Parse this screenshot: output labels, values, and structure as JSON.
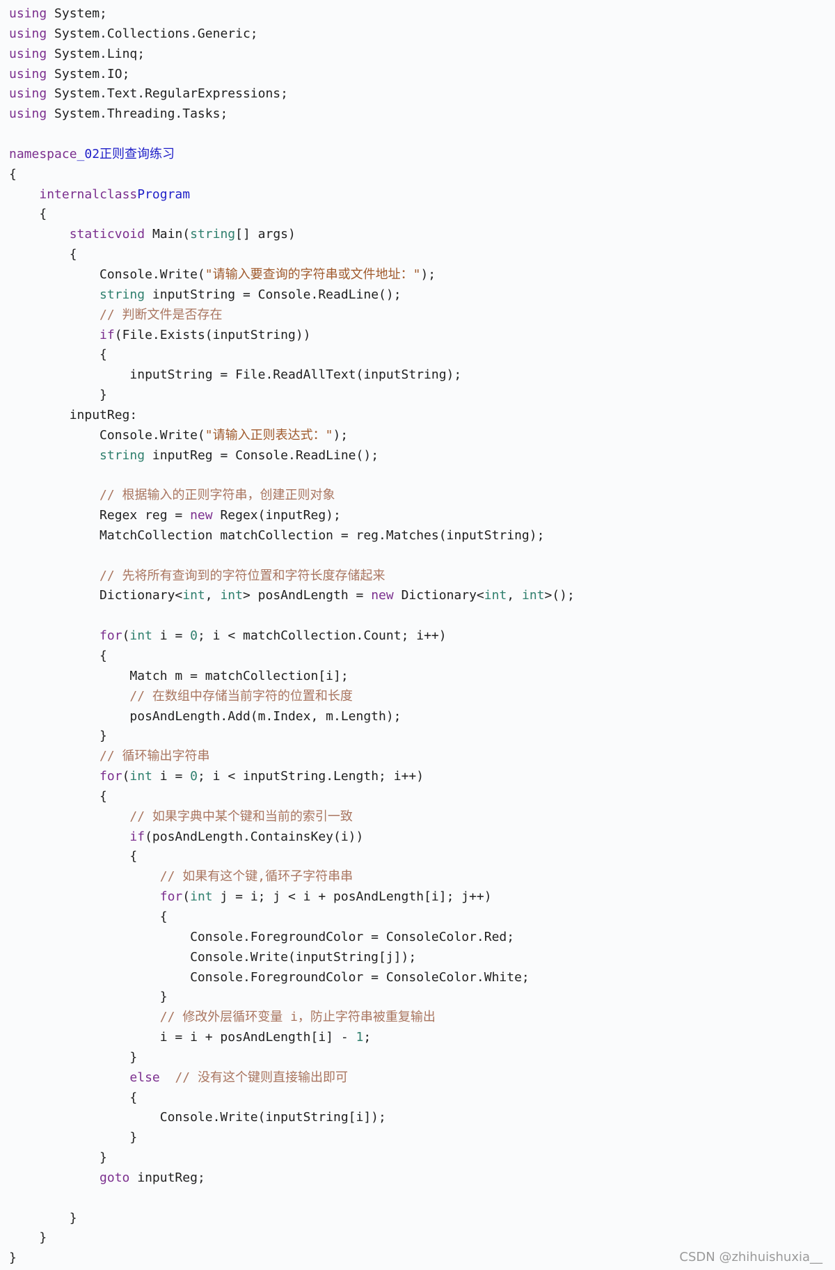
{
  "code": {
    "lines": [
      [
        [
          "kw",
          "using"
        ],
        [
          "",
          "System;"
        ]
      ],
      [
        [
          "kw",
          "using"
        ],
        [
          "",
          "System.Collections.Generic;"
        ]
      ],
      [
        [
          "kw",
          "using"
        ],
        [
          "",
          "System.Linq;"
        ]
      ],
      [
        [
          "kw",
          "using"
        ],
        [
          "",
          "System.IO;"
        ]
      ],
      [
        [
          "kw",
          "using"
        ],
        [
          "",
          "System.Text.RegularExpressions;"
        ]
      ],
      [
        [
          "kw",
          "using"
        ],
        [
          "",
          "System.Threading.Tasks;"
        ]
      ],
      [],
      [
        [
          "kw",
          "namespace"
        ],
        [
          "",
          ""
        ],
        [
          "cls",
          "_02正则查询练习"
        ]
      ],
      [
        [
          "",
          "{"
        ]
      ],
      [
        [
          "",
          "    "
        ],
        [
          "kw",
          "internal"
        ],
        [
          "",
          ""
        ],
        [
          "kw",
          "class"
        ],
        [
          "",
          ""
        ],
        [
          "cls",
          "Program"
        ]
      ],
      [
        [
          "",
          "    {"
        ]
      ],
      [
        [
          "",
          "        "
        ],
        [
          "kw",
          "static"
        ],
        [
          "",
          ""
        ],
        [
          "kw",
          "void"
        ],
        [
          "",
          "Main("
        ],
        [
          "ty",
          "string"
        ],
        [
          "",
          "[] args)"
        ]
      ],
      [
        [
          "",
          "        {"
        ]
      ],
      [
        [
          "",
          "            Console.Write("
        ],
        [
          "str",
          "\"请输入要查询的字符串或文件地址：\""
        ],
        [
          "",
          ");"
        ]
      ],
      [
        [
          "",
          "            "
        ],
        [
          "ty",
          "string"
        ],
        [
          "",
          "inputString = Console.ReadLine();"
        ]
      ],
      [
        [
          "",
          "            "
        ],
        [
          "cm",
          "// 判断文件是否存在"
        ]
      ],
      [
        [
          "",
          "            "
        ],
        [
          "kw",
          "if"
        ],
        [
          "",
          "(File.Exists(inputString))"
        ]
      ],
      [
        [
          "",
          "            {"
        ]
      ],
      [
        [
          "",
          "                inputString = File.ReadAllText(inputString);"
        ]
      ],
      [
        [
          "",
          "            }"
        ]
      ],
      [
        [
          "",
          "        inputReg:"
        ]
      ],
      [
        [
          "",
          "            Console.Write("
        ],
        [
          "str",
          "\"请输入正则表达式：\""
        ],
        [
          "",
          ");"
        ]
      ],
      [
        [
          "",
          "            "
        ],
        [
          "ty",
          "string"
        ],
        [
          "",
          "inputReg = Console.ReadLine();"
        ]
      ],
      [],
      [
        [
          "",
          "            "
        ],
        [
          "cm",
          "// 根据输入的正则字符串，创建正则对象"
        ]
      ],
      [
        [
          "",
          "            Regex reg = "
        ],
        [
          "kw",
          "new"
        ],
        [
          "",
          "Regex(inputReg);"
        ]
      ],
      [
        [
          "",
          "            MatchCollection matchCollection = reg.Matches(inputString);"
        ]
      ],
      [],
      [
        [
          "",
          "            "
        ],
        [
          "cm",
          "// 先将所有查询到的字符位置和字符长度存储起来"
        ]
      ],
      [
        [
          "",
          "            Dictionary<"
        ],
        [
          "ty",
          "int"
        ],
        [
          "",
          ", "
        ],
        [
          "ty",
          "int"
        ],
        [
          "",
          "> posAndLength = "
        ],
        [
          "kw",
          "new"
        ],
        [
          "",
          "Dictionary<"
        ],
        [
          "ty",
          "int"
        ],
        [
          "",
          ", "
        ],
        [
          "ty",
          "int"
        ],
        [
          "",
          ">();"
        ]
      ],
      [],
      [
        [
          "",
          "            "
        ],
        [
          "kw",
          "for"
        ],
        [
          "",
          "("
        ],
        [
          "ty",
          "int"
        ],
        [
          "",
          "i = "
        ],
        [
          "num",
          "0"
        ],
        [
          "",
          "; i < matchCollection.Count; i++)"
        ]
      ],
      [
        [
          "",
          "            {"
        ]
      ],
      [
        [
          "",
          "                Match m = matchCollection[i];"
        ]
      ],
      [
        [
          "",
          "                "
        ],
        [
          "cm",
          "// 在数组中存储当前字符的位置和长度"
        ]
      ],
      [
        [
          "",
          "                posAndLength.Add(m.Index, m.Length);"
        ]
      ],
      [
        [
          "",
          "            }"
        ]
      ],
      [
        [
          "",
          "            "
        ],
        [
          "cm",
          "// 循环输出字符串"
        ]
      ],
      [
        [
          "",
          "            "
        ],
        [
          "kw",
          "for"
        ],
        [
          "",
          "("
        ],
        [
          "ty",
          "int"
        ],
        [
          "",
          "i = "
        ],
        [
          "num",
          "0"
        ],
        [
          "",
          "; i < inputString.Length; i++)"
        ]
      ],
      [
        [
          "",
          "            {"
        ]
      ],
      [
        [
          "",
          "                "
        ],
        [
          "cm",
          "// 如果字典中某个键和当前的索引一致"
        ]
      ],
      [
        [
          "",
          "                "
        ],
        [
          "kw",
          "if"
        ],
        [
          "",
          "(posAndLength.ContainsKey(i))"
        ]
      ],
      [
        [
          "",
          "                {"
        ]
      ],
      [
        [
          "",
          "                    "
        ],
        [
          "cm",
          "// 如果有这个键,循环子字符串串"
        ]
      ],
      [
        [
          "",
          "                    "
        ],
        [
          "kw",
          "for"
        ],
        [
          "",
          "("
        ],
        [
          "ty",
          "int"
        ],
        [
          "",
          "j = i; j < i + posAndLength[i]; j++)"
        ]
      ],
      [
        [
          "",
          "                    {"
        ]
      ],
      [
        [
          "",
          "                        Console.ForegroundColor = ConsoleColor.Red;"
        ]
      ],
      [
        [
          "",
          "                        Console.Write(inputString[j]);"
        ]
      ],
      [
        [
          "",
          "                        Console.ForegroundColor = ConsoleColor.White;"
        ]
      ],
      [
        [
          "",
          "                    }"
        ]
      ],
      [
        [
          "",
          "                    "
        ],
        [
          "cm",
          "// 修改外层循环变量 i，防止字符串被重复输出"
        ]
      ],
      [
        [
          "",
          "                    i = i + posAndLength[i] - "
        ],
        [
          "num",
          "1"
        ],
        [
          "",
          ";"
        ]
      ],
      [
        [
          "",
          "                }"
        ]
      ],
      [
        [
          "",
          "                "
        ],
        [
          "kw",
          "else"
        ],
        [
          "",
          "  "
        ],
        [
          "cm",
          "// 没有这个键则直接输出即可"
        ]
      ],
      [
        [
          "",
          "                {"
        ]
      ],
      [
        [
          "",
          "                    Console.Write(inputString[i]);"
        ]
      ],
      [
        [
          "",
          "                }"
        ]
      ],
      [
        [
          "",
          "            }"
        ]
      ],
      [
        [
          "",
          "            "
        ],
        [
          "kw",
          "goto"
        ],
        [
          "",
          "inputReg;"
        ]
      ],
      [],
      [
        [
          "",
          "        }"
        ]
      ],
      [
        [
          "",
          "    }"
        ]
      ],
      [
        [
          "",
          "}"
        ]
      ]
    ]
  },
  "watermark": "CSDN @zhihuishuxia__"
}
